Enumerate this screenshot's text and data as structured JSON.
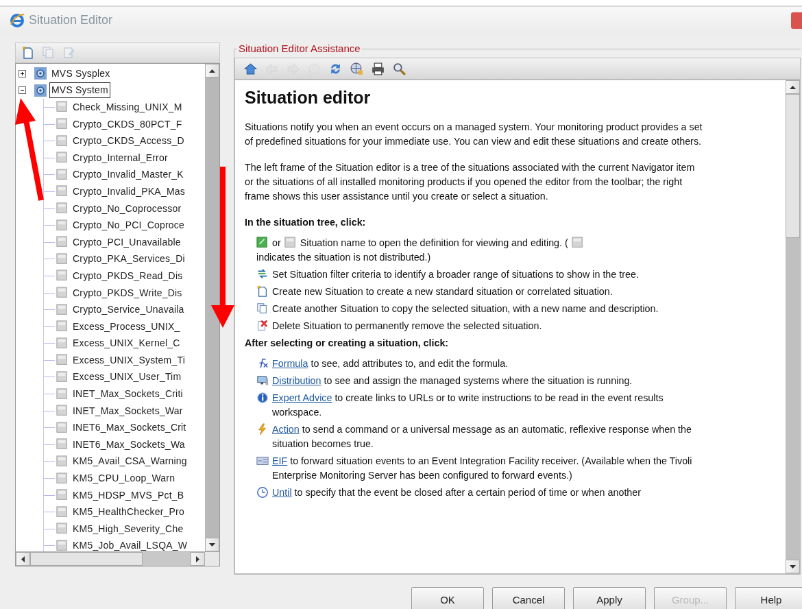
{
  "window": {
    "title": "Situation Editor"
  },
  "tree_toolbar": [
    {
      "disabled": false
    },
    {
      "disabled": true
    },
    {
      "disabled": true
    }
  ],
  "tree": [
    {
      "label": "MVS Sysplex",
      "expanded": false,
      "selected": false
    },
    {
      "label": "MVS System",
      "expanded": true,
      "selected": true,
      "children": [
        {
          "label": "Check_Missing_UNIX_M"
        },
        {
          "label": "Crypto_CKDS_80PCT_F"
        },
        {
          "label": "Crypto_CKDS_Access_D"
        },
        {
          "label": "Crypto_Internal_Error"
        },
        {
          "label": "Crypto_Invalid_Master_K"
        },
        {
          "label": "Crypto_Invalid_PKA_Mas"
        },
        {
          "label": "Crypto_No_Coprocessor"
        },
        {
          "label": "Crypto_No_PCI_Coproce"
        },
        {
          "label": "Crypto_PCI_Unavailable"
        },
        {
          "label": "Crypto_PKA_Services_Di"
        },
        {
          "label": "Crypto_PKDS_Read_Dis"
        },
        {
          "label": "Crypto_PKDS_Write_Dis"
        },
        {
          "label": "Crypto_Service_Unavaila"
        },
        {
          "label": "Excess_Process_UNIX_"
        },
        {
          "label": "Excess_UNIX_Kernel_C"
        },
        {
          "label": "Excess_UNIX_System_Ti"
        },
        {
          "label": "Excess_UNIX_User_Tim"
        },
        {
          "label": "INET_Max_Sockets_Criti"
        },
        {
          "label": "INET_Max_Sockets_War"
        },
        {
          "label": "INET6_Max_Sockets_Crit"
        },
        {
          "label": "INET6_Max_Sockets_Wa"
        },
        {
          "label": "KM5_Avail_CSA_Warning"
        },
        {
          "label": "KM5_CPU_Loop_Warn"
        },
        {
          "label": "KM5_HDSP_MVS_Pct_B"
        },
        {
          "label": "KM5_HealthChecker_Pro"
        },
        {
          "label": "KM5_High_Severity_Che"
        },
        {
          "label": "KM5_Job_Avail_LSQA_W"
        }
      ]
    }
  ],
  "help": {
    "legend": "Situation Editor Assistance",
    "toolbar": [
      {
        "disabled": false
      },
      {
        "disabled": true
      },
      {
        "disabled": true
      },
      {
        "disabled": true
      },
      {
        "disabled": false
      },
      {
        "disabled": false
      },
      {
        "disabled": false
      },
      {
        "disabled": false
      }
    ],
    "title": "Situation editor",
    "blocks": [
      {
        "kind": "paragraph",
        "text": "Situations notify you when an event occurs on a managed system. Your monitoring product provides a set of predefined situations for your immediate use. You can view and edit these situations and create others."
      },
      {
        "kind": "paragraph",
        "text": "The left frame of the Situation editor is a tree of the situations associated with the current Navigator item or the situations of all installed monitoring products if you opened the editor from the toolbar; the right frame shows this user assistance until you create or select a situation."
      },
      {
        "kind": "heading",
        "text": "In the situation tree, click:"
      },
      {
        "kind": "item",
        "parts": [
          {
            "kind": "icon"
          },
          {
            "kind": "text",
            "text": "or"
          },
          {
            "kind": "icon"
          },
          {
            "kind": "text",
            "text": "Situation name to open the definition for viewing and editing. ("
          },
          {
            "kind": "icon"
          },
          {
            "kind": "text",
            "text": "indicates the situation is not distributed.)"
          }
        ]
      },
      {
        "kind": "item",
        "parts": [
          {
            "kind": "icon"
          },
          {
            "kind": "text",
            "text": "Set Situation filter criteria to identify a broader range of situations to show in the tree."
          }
        ]
      },
      {
        "kind": "item",
        "parts": [
          {
            "kind": "icon"
          },
          {
            "kind": "text",
            "text": "Create new Situation to create a new standard situation or correlated situation."
          }
        ]
      },
      {
        "kind": "item",
        "parts": [
          {
            "kind": "icon"
          },
          {
            "kind": "text",
            "text": "Create another Situation to copy the selected situation, with a new name and description."
          }
        ]
      },
      {
        "kind": "item",
        "parts": [
          {
            "kind": "icon"
          },
          {
            "kind": "text",
            "text": "Delete Situation to permanently remove the selected situation."
          }
        ]
      },
      {
        "kind": "heading",
        "text": "After selecting or creating a situation, click:"
      },
      {
        "kind": "item",
        "parts": [
          {
            "kind": "icon"
          },
          {
            "kind": "link",
            "text": "Formula"
          },
          {
            "kind": "text",
            "text": " to see, add attributes to, and edit the formula."
          }
        ]
      },
      {
        "kind": "item",
        "parts": [
          {
            "kind": "icon"
          },
          {
            "kind": "link",
            "text": "Distribution"
          },
          {
            "kind": "text",
            "text": " to see and assign the managed systems where the situation is running."
          }
        ]
      },
      {
        "kind": "item",
        "parts": [
          {
            "kind": "icon"
          },
          {
            "kind": "link",
            "text": "Expert Advice"
          },
          {
            "kind": "text",
            "text": " to create links to URLs or to write instructions to be read in the event results workspace."
          }
        ]
      },
      {
        "kind": "item",
        "parts": [
          {
            "kind": "icon"
          },
          {
            "kind": "link",
            "text": "Action"
          },
          {
            "kind": "text",
            "text": " to send a command or a universal message as an automatic, reflexive response when the situation becomes true."
          }
        ]
      },
      {
        "kind": "item",
        "parts": [
          {
            "kind": "icon"
          },
          {
            "kind": "link",
            "text": "EIF"
          },
          {
            "kind": "text",
            "text": " to forward situation events to an Event Integration Facility receiver. (Available when the Tivoli Enterprise Monitoring Server has been configured to forward events.)"
          }
        ]
      },
      {
        "kind": "item",
        "parts": [
          {
            "kind": "icon"
          },
          {
            "kind": "link",
            "text": "Until"
          },
          {
            "kind": "text",
            "text": " to specify that the event be closed after a certain period of time or when another"
          }
        ]
      }
    ]
  },
  "buttons": [
    {
      "label": "OK",
      "disabled": false
    },
    {
      "label": "Cancel",
      "disabled": false
    },
    {
      "label": "Apply",
      "disabled": false
    },
    {
      "label": "Group...",
      "disabled": true
    },
    {
      "label": "Help",
      "disabled": false
    }
  ]
}
